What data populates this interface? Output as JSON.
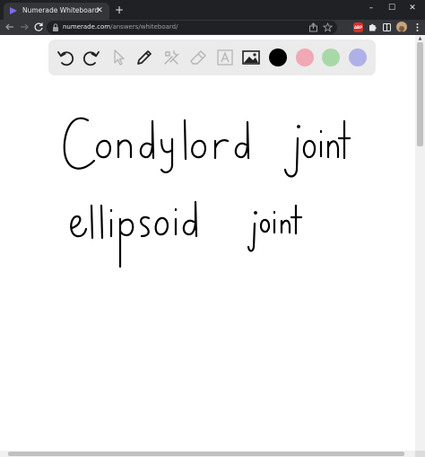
{
  "browser": {
    "tab": {
      "title": "Numerade Whiteboard",
      "favicon": "numerade-logo-icon",
      "close_glyph": "✕"
    },
    "new_tab_glyph": "+",
    "window_controls": [
      "–",
      "☐",
      "✕"
    ],
    "address_bar": {
      "domain": "numerade.com",
      "path": "/answers/whiteboard/"
    },
    "extension_badge": "ABP"
  },
  "whiteboard": {
    "tools": [
      {
        "name": "undo",
        "icon": "undo-icon",
        "enabled": true
      },
      {
        "name": "redo",
        "icon": "redo-icon",
        "enabled": true
      },
      {
        "name": "select",
        "icon": "cursor-icon",
        "enabled": false
      },
      {
        "name": "pen",
        "icon": "pencil-icon",
        "enabled": true
      },
      {
        "name": "tools",
        "icon": "hammer-wrench-icon",
        "enabled": false
      },
      {
        "name": "eraser",
        "icon": "eraser-icon",
        "enabled": false
      },
      {
        "name": "text",
        "icon": "text-box-icon",
        "enabled": false
      },
      {
        "name": "image",
        "icon": "image-icon",
        "enabled": true
      }
    ],
    "colors": [
      "#000000",
      "#f0a8b4",
      "#a8d8a8",
      "#b0b0e8"
    ],
    "handwriting_lines": [
      "Condylord joint",
      "ellipsoid joint"
    ]
  }
}
